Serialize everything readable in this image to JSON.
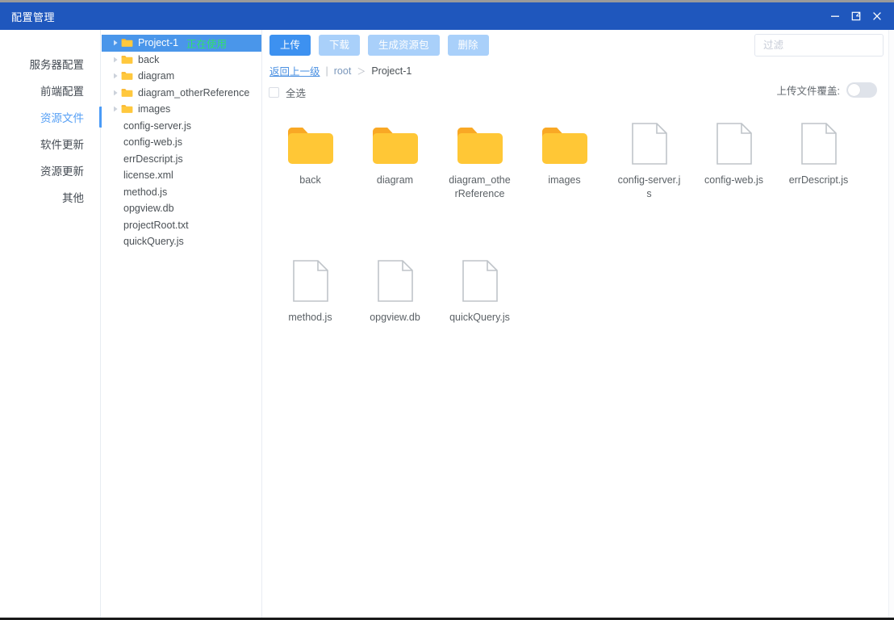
{
  "window": {
    "title": "配置管理",
    "accent": "#1f57bd",
    "controls": [
      {
        "name": "minimize",
        "icon": "minimize-icon"
      },
      {
        "name": "maximize",
        "icon": "maximize-icon"
      },
      {
        "name": "close",
        "icon": "close-icon"
      }
    ]
  },
  "sidebar": {
    "active_index": 2,
    "active_color": "#57a0f5",
    "items": [
      {
        "label": "服务器配置"
      },
      {
        "label": "前端配置"
      },
      {
        "label": "资源文件"
      },
      {
        "label": "软件更新"
      },
      {
        "label": "资源更新"
      },
      {
        "label": "其他"
      }
    ]
  },
  "tree": {
    "selected_bg": "#4a96ea",
    "folder_color": "#ffc83d",
    "in_use_tag": "正在使用",
    "nodes": [
      {
        "label": "Project-1",
        "type": "folder",
        "selected": true,
        "expandable": true,
        "tag": "正在使用"
      },
      {
        "label": "back",
        "type": "folder",
        "selected": false,
        "expandable": true,
        "tag": ""
      },
      {
        "label": "diagram",
        "type": "folder",
        "selected": false,
        "expandable": true,
        "tag": ""
      },
      {
        "label": "diagram_otherReference",
        "type": "folder",
        "selected": false,
        "expandable": true,
        "tag": ""
      },
      {
        "label": "images",
        "type": "folder",
        "selected": false,
        "expandable": true,
        "tag": ""
      },
      {
        "label": "config-server.js",
        "type": "file",
        "selected": false,
        "expandable": false,
        "tag": ""
      },
      {
        "label": "config-web.js",
        "type": "file",
        "selected": false,
        "expandable": false,
        "tag": ""
      },
      {
        "label": "errDescript.js",
        "type": "file",
        "selected": false,
        "expandable": false,
        "tag": ""
      },
      {
        "label": "license.xml",
        "type": "file",
        "selected": false,
        "expandable": false,
        "tag": ""
      },
      {
        "label": "method.js",
        "type": "file",
        "selected": false,
        "expandable": false,
        "tag": ""
      },
      {
        "label": "opgview.db",
        "type": "file",
        "selected": false,
        "expandable": false,
        "tag": ""
      },
      {
        "label": "projectRoot.txt",
        "type": "file",
        "selected": false,
        "expandable": false,
        "tag": ""
      },
      {
        "label": "quickQuery.js",
        "type": "file",
        "selected": false,
        "expandable": false,
        "tag": ""
      }
    ]
  },
  "toolbar": {
    "upload_label": "上传",
    "download_label": "下载",
    "package_label": "生成资源包",
    "delete_label": "删除",
    "primary_color": "#3d91f0",
    "disabled_color": "#a9d0fa"
  },
  "filter": {
    "value": "",
    "placeholder": "过滤"
  },
  "breadcrumb": {
    "back_label": "返回上一级",
    "divider": "|",
    "root_label": "root",
    "separator": "＞",
    "current_label": "Project-1"
  },
  "select_all": {
    "label": "全选",
    "checked": false
  },
  "overwrite": {
    "label": "上传文件覆盖:",
    "enabled": false
  },
  "grid": {
    "items": [
      {
        "name": "back",
        "type": "folder"
      },
      {
        "name": "diagram",
        "type": "folder"
      },
      {
        "name": "diagram_otherReference",
        "type": "folder"
      },
      {
        "name": "images",
        "type": "folder"
      },
      {
        "name": "config-server.js",
        "type": "file"
      },
      {
        "name": "config-web.js",
        "type": "file"
      },
      {
        "name": "errDescript.js",
        "type": "file"
      },
      {
        "name": "method.js",
        "type": "file"
      },
      {
        "name": "opgview.db",
        "type": "file"
      },
      {
        "name": "quickQuery.js",
        "type": "file"
      }
    ]
  }
}
